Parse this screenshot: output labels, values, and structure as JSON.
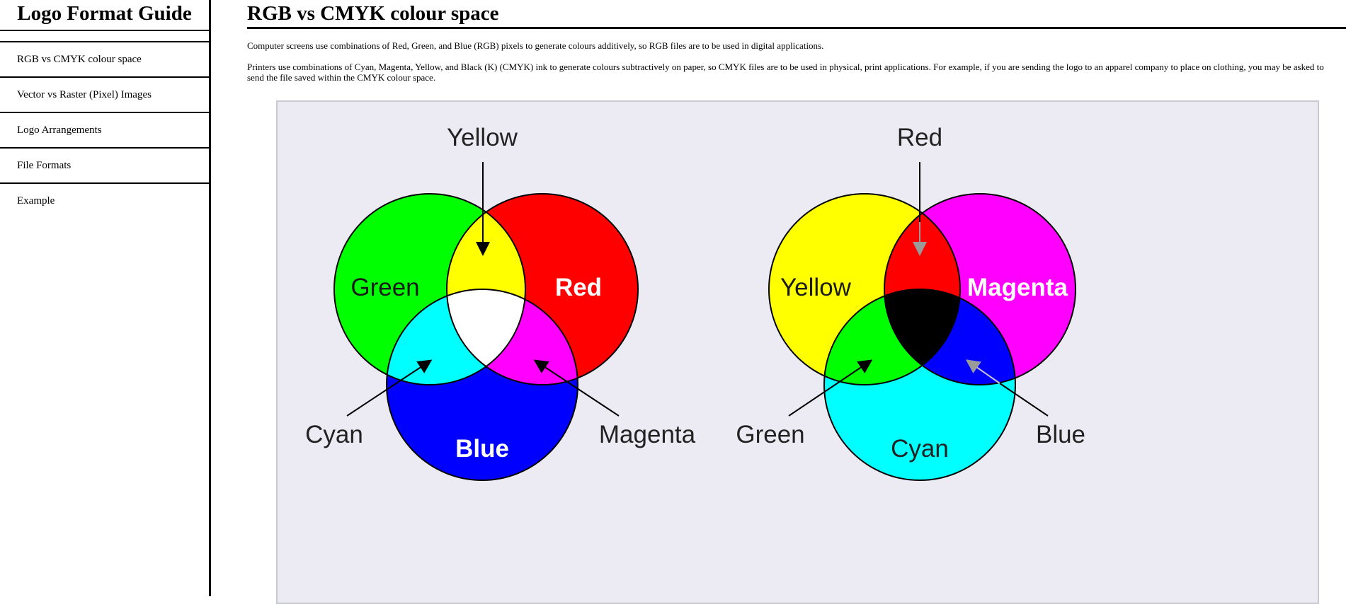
{
  "sidebar": {
    "title": "Logo Format Guide",
    "items": [
      {
        "label": "RGB vs CMYK colour space"
      },
      {
        "label": "Vector vs Raster (Pixel) Images"
      },
      {
        "label": "Logo Arrangements"
      },
      {
        "label": "File Formats"
      },
      {
        "label": "Example"
      }
    ]
  },
  "main": {
    "title": "RGB vs CMYK colour space",
    "paragraphs": [
      "Computer screens use combinations of Red, Green, and Blue (RGB) pixels to generate colours additively, so RGB files are to be used in digital applications.",
      "Printers use combinations of Cyan, Magenta, Yellow, and Black (K) (CMYK) ink to generate colours subtractively on paper, so CMYK files are to be used in physical, print applications. For example, if you are sending the logo to an apparel company to place on clothing, you may be asked to send the file saved within the CMYK colour space."
    ]
  },
  "diagram": {
    "rgb": {
      "top_label": "Yellow",
      "left_circle": "Green",
      "right_circle": "Red",
      "bottom_circle": "Blue",
      "left_label": "Cyan",
      "right_label": "Magenta",
      "colors": {
        "green": "#00ff00",
        "red": "#ff0000",
        "blue": "#0000ff",
        "yellow": "#ffff00",
        "cyan": "#00ffff",
        "magenta": "#ff00ff",
        "white": "#ffffff"
      }
    },
    "cmyk": {
      "top_label": "Red",
      "left_circle": "Yellow",
      "right_circle": "Magenta",
      "bottom_circle": "Cyan",
      "left_label": "Green",
      "right_label": "Blue",
      "colors": {
        "yellow": "#ffff00",
        "magenta": "#ff00ff",
        "cyan": "#00ffff",
        "red": "#ff0000",
        "green": "#00ff00",
        "blue": "#0000ff",
        "black": "#000000"
      }
    }
  }
}
